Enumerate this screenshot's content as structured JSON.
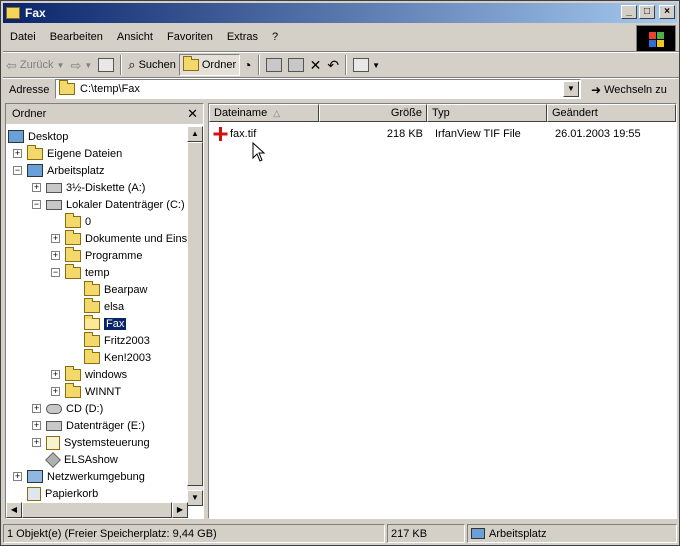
{
  "window": {
    "title": "Fax"
  },
  "menu": [
    "Datei",
    "Bearbeiten",
    "Ansicht",
    "Favoriten",
    "Extras",
    "?"
  ],
  "toolbar": {
    "back": "Zurück",
    "search": "Suchen",
    "folders": "Ordner"
  },
  "address": {
    "label": "Adresse",
    "path": "C:\\temp\\Fax",
    "go": "Wechseln zu"
  },
  "left_pane": {
    "title": "Ordner",
    "tree": [
      {
        "label": "Desktop",
        "icon": "desktop-icon"
      },
      {
        "label": "Eigene Dateien",
        "icon": "folder-icon"
      },
      {
        "label": "Arbeitsplatz",
        "icon": "computer-icon"
      },
      {
        "label": "3½-Diskette (A:)",
        "icon": "floppy-icon"
      },
      {
        "label": "Lokaler Datenträger (C:)",
        "icon": "drive-icon"
      },
      {
        "label": "0",
        "icon": "folder-icon"
      },
      {
        "label": "Dokumente und Einste",
        "icon": "folder-icon"
      },
      {
        "label": "Programme",
        "icon": "folder-icon"
      },
      {
        "label": "temp",
        "icon": "folder-icon"
      },
      {
        "label": "Bearpaw",
        "icon": "folder-icon"
      },
      {
        "label": "elsa",
        "icon": "folder-icon"
      },
      {
        "label": "Fax",
        "icon": "folder-open-icon",
        "selected": true
      },
      {
        "label": "Fritz2003",
        "icon": "folder-icon"
      },
      {
        "label": "Ken!2003",
        "icon": "folder-icon"
      },
      {
        "label": "windows",
        "icon": "folder-icon"
      },
      {
        "label": "WINNT",
        "icon": "folder-icon"
      },
      {
        "label": "CD (D:)",
        "icon": "cd-drive-icon"
      },
      {
        "label": "Datenträger (E:)",
        "icon": "drive-icon"
      },
      {
        "label": "Systemsteuerung",
        "icon": "control-panel-icon"
      },
      {
        "label": "ELSAshow",
        "icon": "cube-icon"
      },
      {
        "label": "Netzwerkumgebung",
        "icon": "network-icon"
      },
      {
        "label": "Papierkorb",
        "icon": "recycle-bin-icon"
      }
    ]
  },
  "file_list": {
    "columns": [
      "Dateiname",
      "Größe",
      "Typ",
      "Geändert"
    ],
    "rows": [
      {
        "name": "fax.tif",
        "size": "218 KB",
        "type": "IrfanView TIF File",
        "modified": "26.01.2003 19:55"
      }
    ]
  },
  "status": {
    "objects": "1 Objekt(e) (Freier Speicherplatz: 9,44 GB)",
    "size": "217 KB",
    "location": "Arbeitsplatz"
  },
  "colors": {
    "title_start": "#0a246a",
    "title_end": "#a6caf0",
    "selection": "#0a246a",
    "face": "#d4d0c8"
  }
}
